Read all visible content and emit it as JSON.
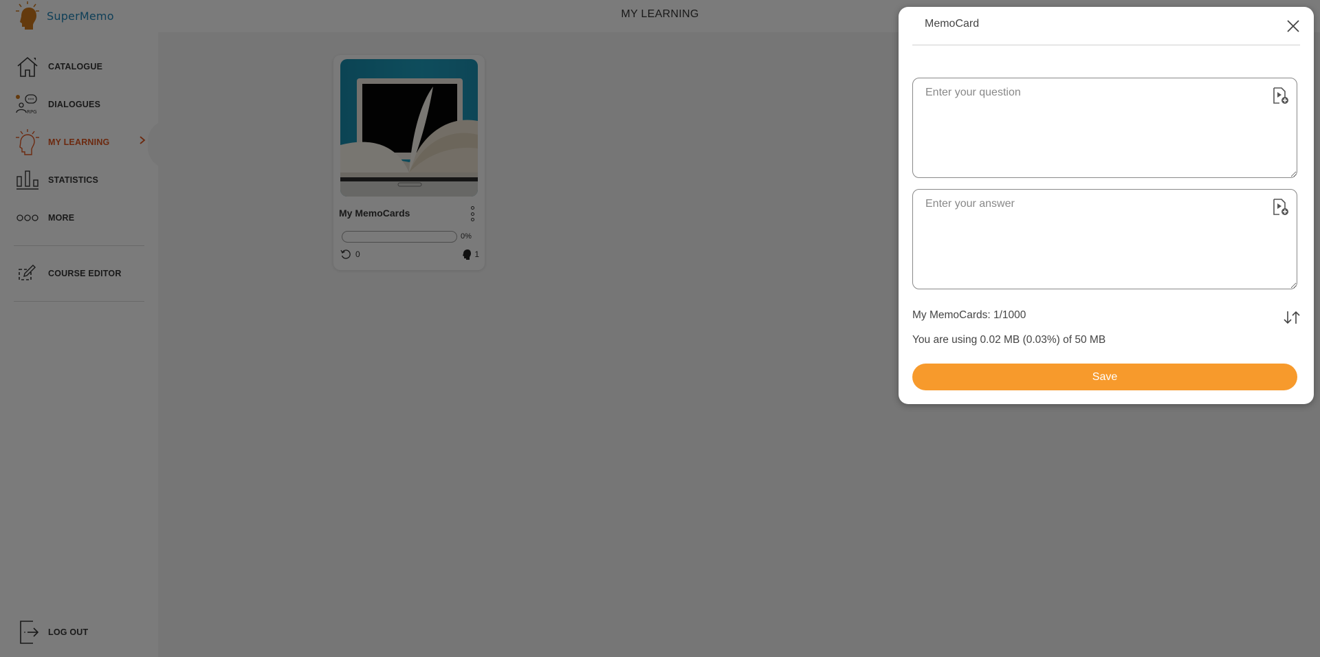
{
  "app": {
    "name": "SuperMemo",
    "page_title": "MY LEARNING"
  },
  "colors": {
    "brand_blue": "#1f7fb0",
    "accent_orange": "#f79a2c",
    "active_nav": "#d9531e"
  },
  "sidebar": {
    "items": [
      {
        "label": "CATALOGUE",
        "icon": "home-icon"
      },
      {
        "label": "DIALOGUES",
        "icon": "rpg-dialogue-icon"
      },
      {
        "label": "MY LEARNING",
        "icon": "lightbulb-head-icon",
        "active": true
      },
      {
        "label": "STATISTICS",
        "icon": "bar-chart-icon"
      },
      {
        "label": "MORE",
        "icon": "more-dots-icon"
      }
    ],
    "course_editor": {
      "label": "COURSE EDITOR",
      "icon": "edit-icon"
    },
    "logout": {
      "label": "LOG OUT",
      "icon": "logout-icon"
    }
  },
  "course_card": {
    "title": "My MemoCards",
    "progress_percent": 0,
    "progress_label": "0%",
    "reviews": "0",
    "cards": "1"
  },
  "modal": {
    "title": "MemoCard",
    "question_placeholder": "Enter your question",
    "question_value": "",
    "answer_placeholder": "Enter your answer",
    "answer_value": "",
    "memocards_count": "My MemoCards: 1/1000",
    "storage_usage": "You are using 0.02 MB (0.03%) of 50 MB",
    "save_label": "Save"
  }
}
